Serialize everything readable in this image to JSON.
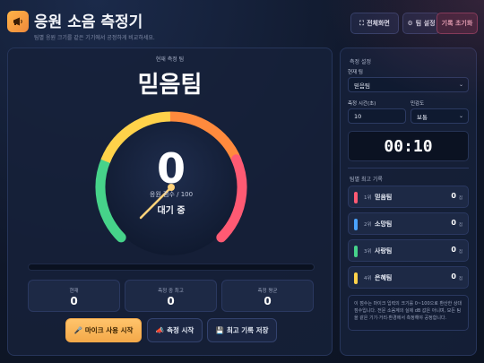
{
  "header": {
    "title": "응원 소음 측정기",
    "subtitle": "팀별 응원 크기를 같은 기기에서 공정하게 비교하세요.",
    "logo_icon": "megaphone-icon",
    "buttons": {
      "fullscreen": {
        "icon": "⛶",
        "label": "전체화면"
      },
      "team_settings": {
        "icon": "⚙",
        "label": "팀 설정"
      },
      "reset_records": {
        "label": "기록 초기화"
      }
    }
  },
  "main": {
    "current_label": "현재 측정 팀",
    "team_name": "믿음팀",
    "gauge": {
      "score": "0",
      "score_label": "응원 점수 / 100",
      "status": "대기 중",
      "max": 100,
      "needle_value": 0
    },
    "progress_fraction": 0,
    "stats": [
      {
        "label": "현재",
        "value": "0"
      },
      {
        "label": "측정 중 최고",
        "value": "0"
      },
      {
        "label": "측정 평균",
        "value": "0"
      }
    ],
    "actions": {
      "mic": {
        "icon": "🎤",
        "label": "마이크 사용 시작"
      },
      "measure": {
        "icon": "📣",
        "label": "측정 시작"
      },
      "save": {
        "icon": "💾",
        "label": "최고 기록 저장"
      }
    }
  },
  "sidebar": {
    "settings_title": "측정 설정",
    "team_field": {
      "label": "현재 팀",
      "value": "믿음팀"
    },
    "time_field": {
      "label": "측정 시간(초)",
      "value": "10"
    },
    "sensitivity_field": {
      "label": "민감도",
      "value": "보통"
    },
    "timer": "00:10",
    "ranking_title": "팀별 최고 기록",
    "score_unit": "점",
    "ranking": [
      {
        "rank": "1위",
        "name": "믿음팀",
        "score": "0",
        "color": "#ff5a73"
      },
      {
        "rank": "2위",
        "name": "소망팀",
        "score": "0",
        "color": "#4aa3ff"
      },
      {
        "rank": "3위",
        "name": "사랑팀",
        "score": "0",
        "color": "#46d38a"
      },
      {
        "rank": "4위",
        "name": "은혜팀",
        "score": "0",
        "color": "#ffd24a"
      }
    ],
    "note": "이 점수는 마이크 입력의 크기를 0~100으로 환산한 상대 점수입니다. 전문 소음계의 실제 dB 값은 아니며, 모든 팀을 같은 기기·거리·환경에서 측정해야 공정합니다."
  },
  "colors": {
    "gauge_segments": [
      "#46d38a",
      "#ffd24a",
      "#ff8a3d",
      "#ff5a73"
    ],
    "needle": "#ffd27a",
    "accent": "#f4a94a"
  }
}
